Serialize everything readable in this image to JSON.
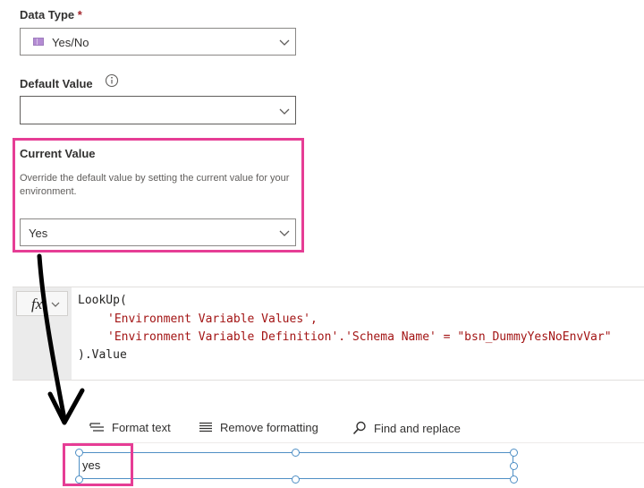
{
  "data_type": {
    "label": "Data Type",
    "required_mark": "*",
    "value": "Yes/No"
  },
  "default_value": {
    "label": "Default Value",
    "value": ""
  },
  "current_value": {
    "label": "Current Value",
    "description": "Override the default value by setting the current value for your environment.",
    "value": "Yes"
  },
  "formula_bar": {
    "fx_label": "fx",
    "lines": {
      "l1": "LookUp(",
      "l2": "'Environment Variable Values',",
      "l3a": "'Environment Variable Definition'.'Schema Name' = ",
      "l3b": "\"bsn_DummyYesNoEnvVar\"",
      "l4": ").Value"
    }
  },
  "toolbar": {
    "format_text": "Format text",
    "remove_formatting": "Remove formatting",
    "find_replace": "Find and replace"
  },
  "label_control": {
    "text": "yes"
  },
  "colors": {
    "highlight": "#e63d95",
    "selection": "#4f8fc5",
    "string": "#a31515"
  }
}
